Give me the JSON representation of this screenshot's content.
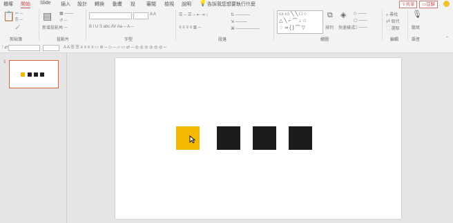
{
  "tabs": [
    "櫃塚",
    "開始",
    "Slide",
    "插入",
    "設計",
    "轉換",
    "動畫",
    "投",
    "審閱",
    "檢視",
    "說明",
    "Ω"
  ],
  "active_tab_index": 1,
  "tell_me": "告訴我您想要執行什麼",
  "share_label": "共享",
  "comment_label": "註解",
  "ribbon": {
    "clipboard_label": "剪貼簿",
    "slides_label": "投影片",
    "font_label": "字型",
    "paragraph_label": "段落",
    "drawing_label": "繪圖",
    "editing_label": "編輯",
    "voice_label": "語音",
    "new_slide": "新增投影片",
    "reuse": "重複使用",
    "arrange": "排列",
    "quick_styles": "快速樣式",
    "find": "尋找",
    "replace": "取代",
    "select": "選取",
    "dictate": "聽寫"
  },
  "slide_number": "1",
  "slide_squares": [
    {
      "name": "yellow-square",
      "color": "#f5b800"
    },
    {
      "name": "black-square",
      "color": "#1c1c1c"
    },
    {
      "name": "black-square",
      "color": "#1c1c1c"
    },
    {
      "name": "black-square",
      "color": "#1c1c1c"
    }
  ],
  "colors": {
    "accent": "#c0504d",
    "yellow": "#f5b800",
    "dark": "#1c1c1c"
  },
  "cursor_icon": "arrow-pointer-icon"
}
